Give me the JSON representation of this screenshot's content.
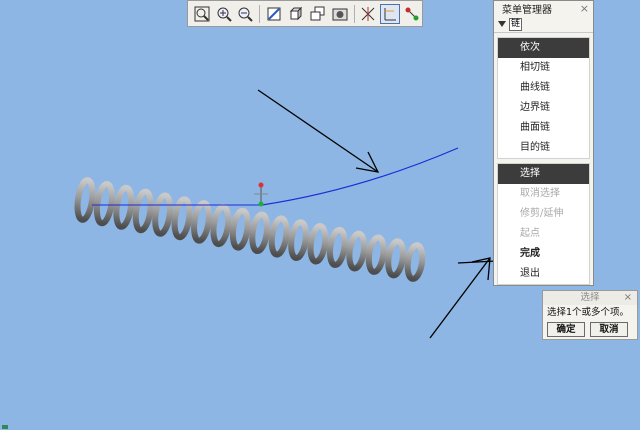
{
  "toolbar": {
    "buttons": [
      {
        "name": "zoom-fit-icon"
      },
      {
        "name": "zoom-in-icon"
      },
      {
        "name": "zoom-out-icon"
      },
      {
        "name": "repaint-icon"
      },
      {
        "name": "view-orient-icon"
      },
      {
        "name": "saved-views-icon"
      },
      {
        "name": "display-style-icon"
      },
      {
        "name": "datum-planes-icon"
      },
      {
        "name": "datum-axes-icon",
        "active": true
      },
      {
        "name": "datum-points-icon"
      }
    ]
  },
  "menu_manager": {
    "title": "菜单管理器",
    "close": "×",
    "chain_label": "链",
    "group1": [
      "依次",
      "相切链",
      "曲线链",
      "边界链",
      "曲面链",
      "目的链"
    ],
    "group1_selected": 0,
    "group2": [
      {
        "label": "选择",
        "state": "selected"
      },
      {
        "label": "取消选择",
        "state": "disabled"
      },
      {
        "label": "修剪/延伸",
        "state": "disabled"
      },
      {
        "label": "起点",
        "state": "disabled"
      },
      {
        "label": "完成",
        "state": "bold"
      },
      {
        "label": "退出",
        "state": "normal"
      }
    ]
  },
  "select_dialog": {
    "title": "选择",
    "close": "×",
    "prompt": "选择1个或多个项。",
    "ok": "确定",
    "cancel": "取消"
  },
  "colors": {
    "background": "#8db6e4",
    "spring": "#8c8c8c",
    "curve": "#1f2bd6",
    "arrow": "#000000",
    "csys_x": "#e03030",
    "csys_y": "#20b030"
  }
}
